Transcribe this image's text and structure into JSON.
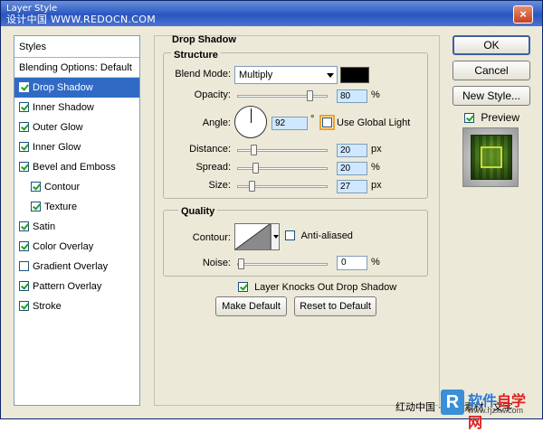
{
  "window": {
    "title": "Layer Style",
    "watermark": "设计中国 WWW.REDOCN.COM",
    "close_label": "×"
  },
  "styles_panel": {
    "header": "Styles",
    "items": [
      {
        "label": "Blending Options: Default",
        "checkbox": false,
        "checked": false,
        "selected": false,
        "indent": false
      },
      {
        "label": "Drop Shadow",
        "checkbox": true,
        "checked": true,
        "selected": true,
        "indent": false
      },
      {
        "label": "Inner Shadow",
        "checkbox": true,
        "checked": true,
        "selected": false,
        "indent": false
      },
      {
        "label": "Outer Glow",
        "checkbox": true,
        "checked": true,
        "selected": false,
        "indent": false
      },
      {
        "label": "Inner Glow",
        "checkbox": true,
        "checked": true,
        "selected": false,
        "indent": false
      },
      {
        "label": "Bevel and Emboss",
        "checkbox": true,
        "checked": true,
        "selected": false,
        "indent": false
      },
      {
        "label": "Contour",
        "checkbox": true,
        "checked": true,
        "selected": false,
        "indent": true
      },
      {
        "label": "Texture",
        "checkbox": true,
        "checked": true,
        "selected": false,
        "indent": true
      },
      {
        "label": "Satin",
        "checkbox": true,
        "checked": true,
        "selected": false,
        "indent": false
      },
      {
        "label": "Color Overlay",
        "checkbox": true,
        "checked": true,
        "selected": false,
        "indent": false
      },
      {
        "label": "Gradient Overlay",
        "checkbox": true,
        "checked": false,
        "selected": false,
        "indent": false
      },
      {
        "label": "Pattern Overlay",
        "checkbox": true,
        "checked": true,
        "selected": false,
        "indent": false
      },
      {
        "label": "Stroke",
        "checkbox": true,
        "checked": true,
        "selected": false,
        "indent": false
      }
    ]
  },
  "drop_shadow": {
    "title": "Drop Shadow",
    "structure": {
      "title": "Structure",
      "blend_mode_label": "Blend Mode:",
      "blend_mode_value": "Multiply",
      "color": "#000000",
      "opacity_label": "Opacity:",
      "opacity_value": "80",
      "opacity_unit": "%",
      "opacity_level": 0.8,
      "angle_label": "Angle:",
      "angle_value": "92",
      "angle_unit": "°",
      "use_global_light_label": "Use Global Light",
      "use_global_light_checked": false,
      "distance_label": "Distance:",
      "distance_value": "20",
      "distance_unit": "px",
      "spread_label": "Spread:",
      "spread_value": "20",
      "spread_unit": "%",
      "size_label": "Size:",
      "size_value": "27",
      "size_unit": "px"
    },
    "quality": {
      "title": "Quality",
      "contour_label": "Contour:",
      "anti_aliased_label": "Anti-aliased",
      "anti_aliased_checked": false,
      "noise_label": "Noise:",
      "noise_value": "0",
      "noise_unit": "%"
    },
    "layer_knocks_out_label": "Layer Knocks Out Drop Shadow",
    "layer_knocks_out_checked": true,
    "make_default_label": "Make Default",
    "reset_default_label": "Reset to Default"
  },
  "side_buttons": {
    "ok_label": "OK",
    "cancel_label": "Cancel",
    "new_style_label": "New Style...",
    "preview_label": "Preview",
    "preview_checked": true
  },
  "footer": {
    "text": "红动中国 · 设计素材 · 文字",
    "brand_prefix": "软件",
    "brand_suffix": "自学网",
    "brand_url": "www.rjzxw.com",
    "brand_icon": "R"
  }
}
